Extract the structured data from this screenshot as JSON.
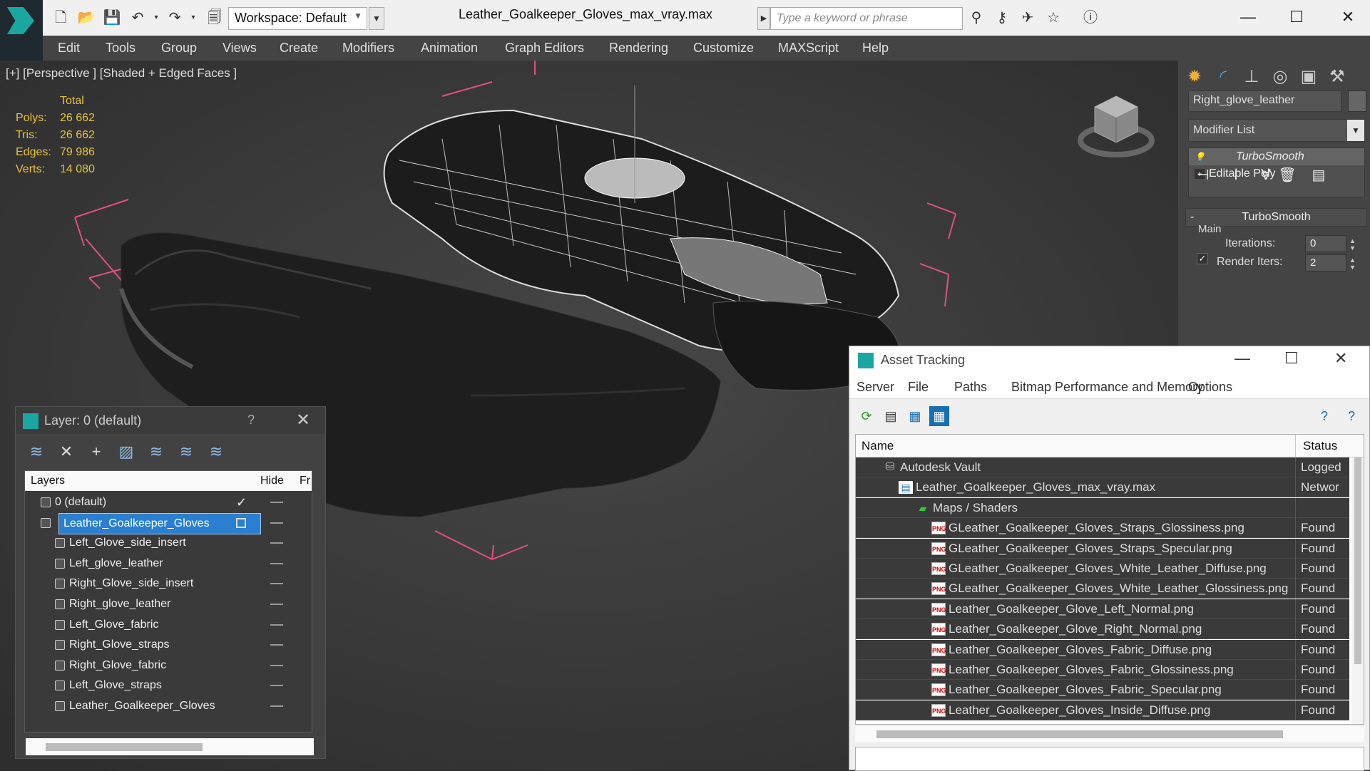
{
  "app": {
    "title": "Leather_Goalkeeper_Gloves_max_vray.max",
    "workspace": "Workspace: Default",
    "search_placeholder": "Type a keyword or phrase"
  },
  "menu": [
    "Edit",
    "Tools",
    "Group",
    "Views",
    "Create",
    "Modifiers",
    "Animation",
    "Graph Editors",
    "Rendering",
    "Customize",
    "MAXScript",
    "Help"
  ],
  "viewport": {
    "label": "[+] [Perspective ] [Shaded + Edged Faces ]",
    "stats": {
      "header": "Total",
      "rows": [
        {
          "label": "Polys:",
          "value": "26 662"
        },
        {
          "label": "Tris:",
          "value": "26 662"
        },
        {
          "label": "Edges:",
          "value": "79 986"
        },
        {
          "label": "Verts:",
          "value": "14 080"
        }
      ]
    }
  },
  "command_panel": {
    "object_name": "Right_glove_leather",
    "modifier_list": "Modifier List",
    "stack": [
      "TurboSmooth",
      "Editable Poly"
    ],
    "rollout_title": "TurboSmooth",
    "group_main": "Main",
    "iterations_label": "Iterations:",
    "iterations_value": "0",
    "render_iters_label": "Render Iters:",
    "render_iters_value": "2"
  },
  "layer_dialog": {
    "title": "Layer: 0 (default)",
    "help": "?",
    "columns": [
      "Layers",
      "Hide",
      "Fr"
    ],
    "rows": [
      {
        "name": "0 (default)",
        "level": 1,
        "type": "layer",
        "current": true
      },
      {
        "name": "Leather_Goalkeeper_Gloves",
        "level": 1,
        "type": "layer",
        "selected": true
      },
      {
        "name": "Left_Glove_side_insert",
        "level": 2,
        "type": "object"
      },
      {
        "name": "Left_glove_leather",
        "level": 2,
        "type": "object"
      },
      {
        "name": "Right_Glove_side_insert",
        "level": 2,
        "type": "object"
      },
      {
        "name": "Right_glove_leather",
        "level": 2,
        "type": "object"
      },
      {
        "name": "Left_Glove_fabric",
        "level": 2,
        "type": "object"
      },
      {
        "name": "Right_Glove_straps",
        "level": 2,
        "type": "object"
      },
      {
        "name": "Right_Glove_fabric",
        "level": 2,
        "type": "object"
      },
      {
        "name": "Left_Glove_straps",
        "level": 2,
        "type": "object"
      },
      {
        "name": "Leather_Goalkeeper_Gloves",
        "level": 2,
        "type": "object"
      }
    ]
  },
  "asset_tracking": {
    "title": "Asset Tracking",
    "menu": [
      "Server",
      "File",
      "Paths",
      "Bitmap Performance and Memory",
      "Options"
    ],
    "columns": [
      "Name",
      "Status"
    ],
    "rows": [
      {
        "name": "Autodesk Vault",
        "status": "Logged",
        "indent": 1,
        "icon": "vault"
      },
      {
        "name": "Leather_Goalkeeper_Gloves_max_vray.max",
        "status": "Networ",
        "indent": 2,
        "icon": "max"
      },
      {
        "name": "Maps / Shaders",
        "status": "",
        "indent": 3,
        "icon": "maps"
      },
      {
        "name": "GLeather_Goalkeeper_Gloves_Straps_Glossiness.png",
        "status": "Found",
        "indent": 4,
        "icon": "png"
      },
      {
        "name": "GLeather_Goalkeeper_Gloves_Straps_Specular.png",
        "status": "Found",
        "indent": 4,
        "icon": "png"
      },
      {
        "name": "GLeather_Goalkeeper_Gloves_White_Leather_Diffuse.png",
        "status": "Found",
        "indent": 4,
        "icon": "png"
      },
      {
        "name": "GLeather_Goalkeeper_Gloves_White_Leather_Glossiness.png",
        "status": "Found",
        "indent": 4,
        "icon": "png"
      },
      {
        "name": "Leather_Goalkeeper_Glove_Left_Normal.png",
        "status": "Found",
        "indent": 4,
        "icon": "png"
      },
      {
        "name": "Leather_Goalkeeper_Glove_Right_Normal.png",
        "status": "Found",
        "indent": 4,
        "icon": "png"
      },
      {
        "name": "Leather_Goalkeeper_Gloves_Fabric_Diffuse.png",
        "status": "Found",
        "indent": 4,
        "icon": "png"
      },
      {
        "name": "Leather_Goalkeeper_Gloves_Fabric_Glossiness.png",
        "status": "Found",
        "indent": 4,
        "icon": "png"
      },
      {
        "name": "Leather_Goalkeeper_Gloves_Fabric_Specular.png",
        "status": "Found",
        "indent": 4,
        "icon": "png"
      },
      {
        "name": "Leather_Goalkeeper_Gloves_Inside_Diffuse.png",
        "status": "Found",
        "indent": 4,
        "icon": "png"
      }
    ]
  },
  "colors": {
    "accent": "#1aa7a2",
    "selection": "#2a7fd0",
    "stats_text": "#e8c23a",
    "bbox_lines": "#e05080"
  }
}
